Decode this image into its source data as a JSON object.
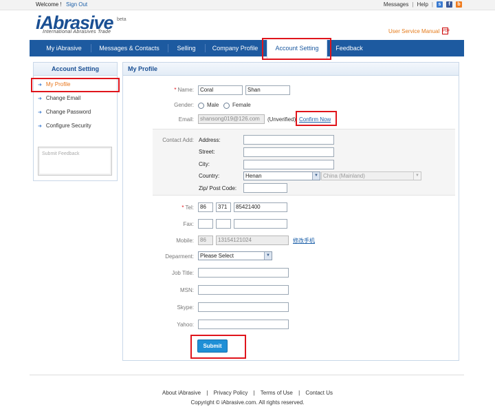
{
  "topbar": {
    "welcome": "Welcome !",
    "sign_out": "Sign Out",
    "messages": "Messages",
    "help": "Help",
    "sep": "|"
  },
  "header": {
    "logo": "iAbrasive",
    "beta": "beta",
    "tagline": "International Abrasives Trade",
    "manual": "User Service Manual"
  },
  "nav": {
    "items": [
      "My iAbrasive",
      "Messages & Contacts",
      "Selling",
      "Company Profile",
      "Account Setting",
      "Feedback"
    ],
    "active": "Account Setting"
  },
  "sidebar": {
    "title": "Account Setting",
    "items": [
      "My Profile",
      "Change Email",
      "Change Password",
      "Configure Security"
    ],
    "active": "My Profile",
    "feedback_placeholder": "Submit Feedback"
  },
  "profile": {
    "title": "My Profile",
    "name_label": "Name:",
    "first_name": "Coral",
    "last_name": "Shan",
    "gender_label": "Gender:",
    "gender_options": [
      "Male",
      "Female"
    ],
    "email_label": "Email:",
    "email": "shansong019@126.com",
    "email_status": "(Unverified)",
    "confirm_link": "Confirm Now",
    "contact_label": "Contact Add:",
    "address_label": "Address:",
    "street_label": "Street:",
    "city_label": "City:",
    "country_label": "Country:",
    "province": "Henan",
    "country": "China (Mainland)",
    "zip_label": "Zip/ Post Code:",
    "tel_label": "Tel:",
    "tel_country": "86",
    "tel_area": "371",
    "tel_number": "85421400",
    "fax_label": "Fax:",
    "mobile_label": "Mobile:",
    "mobile_country": "86",
    "mobile_number": "13154121024",
    "mobile_change": "修改手机",
    "department_label": "Deparment:",
    "department": "Please Select",
    "jobtitle_label": "Job Title:",
    "msn_label": "MSN:",
    "skype_label": "Skype:",
    "yahoo_label": "Yahoo:",
    "submit": "Submit"
  },
  "footer": {
    "links": [
      "About iAbrasive",
      "Privacy Policy",
      "Terms of Use",
      "Contact Us"
    ],
    "sep": "|",
    "copyright": "Copyright © iAbrasive.com. All rights reserved."
  },
  "colors": {
    "nav_bg": "#1d5aa0",
    "highlight": "#e0141b",
    "submit_bg": "#1f8fd6",
    "active_sidebar": "#e8751a"
  }
}
